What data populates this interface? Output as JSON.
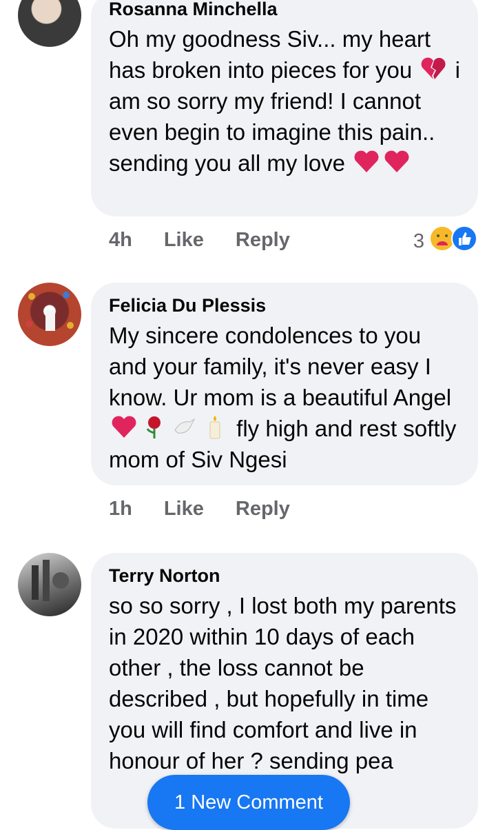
{
  "comments": [
    {
      "author": "Rosanna Minchella",
      "text_1": "Oh my goodness Siv... my heart has broken into pieces for you",
      "text_2": "i am so sorry my friend! I cannot even begin to imagine this pain.. sending you all my love",
      "time": "4h",
      "like": "Like",
      "reply": "Reply",
      "reaction_count": "3",
      "reaction_icons": [
        "care-emoji",
        "like-emoji"
      ]
    },
    {
      "author": "Felicia Du Plessis",
      "text_1": "My sincere condolences to you and your family, it's never easy I know. Ur mom is a beautiful Angel",
      "text_2": "fly high and rest softly mom of Siv Ngesi",
      "emojis": [
        "red-heart",
        "rose",
        "dove",
        "candle"
      ],
      "time": "1h",
      "like": "Like",
      "reply": "Reply"
    },
    {
      "author": "Terry Norton",
      "text": "so so sorry , I lost both my parents in 2020 within 10 days of each other , the loss cannot be described , but hopefully in time you will find comfort and live in honour of her ? sending pea"
    }
  ],
  "new_comment_button": "1 New Comment",
  "colors": {
    "bubble": "#f0f2f5",
    "meta_text": "#65676b",
    "accent": "#1877f2"
  }
}
